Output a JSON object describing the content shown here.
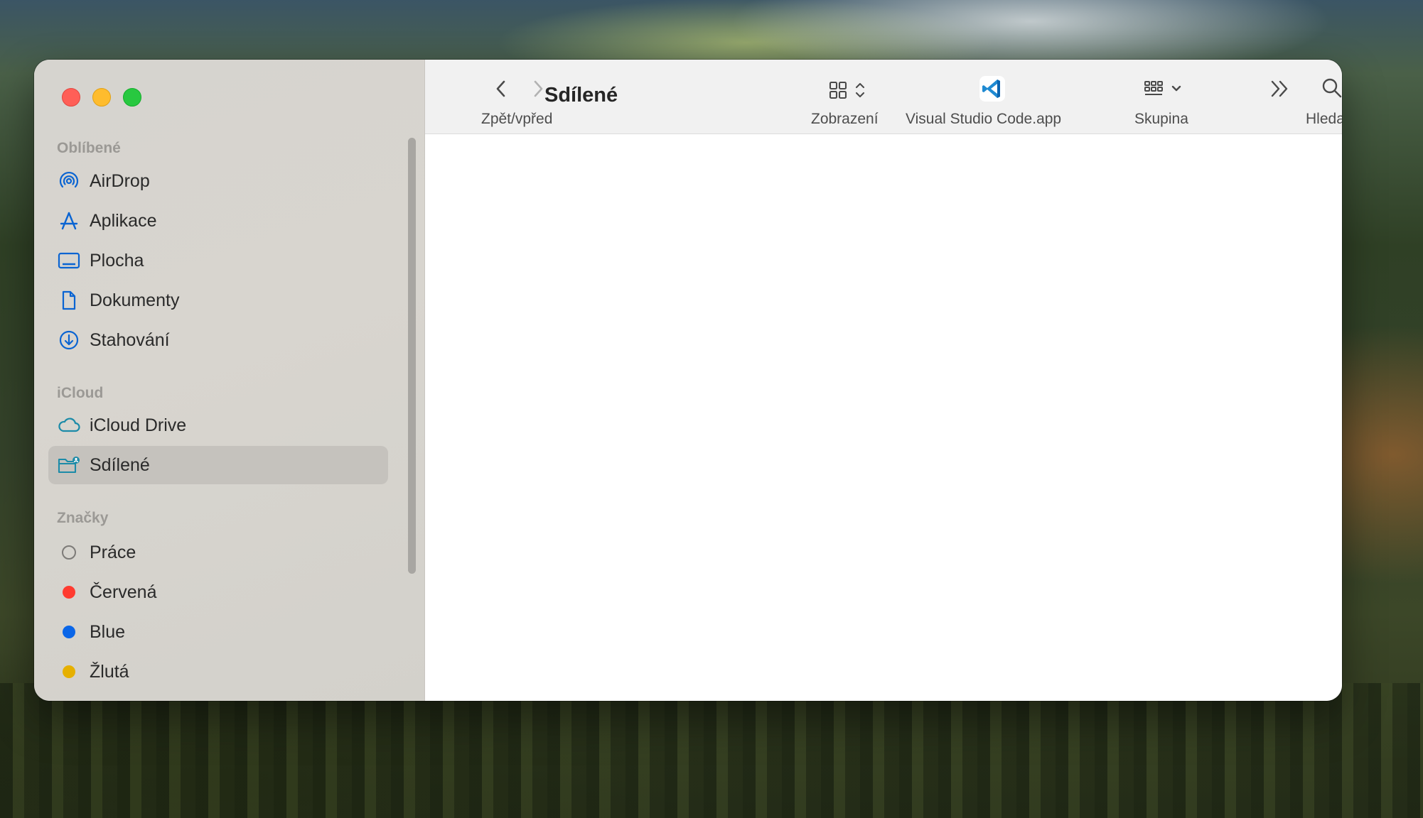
{
  "window": {
    "title": "Sdílené"
  },
  "toolbar": {
    "back_forward_label": "Zpět/vpřed",
    "view_label": "Zobrazení",
    "app_label": "Visual Studio Code.app",
    "group_label": "Skupina",
    "search_label": "Hledat"
  },
  "sidebar": {
    "favorites_title": "Oblíbené",
    "favorites": [
      {
        "label": "AirDrop",
        "icon": "airdrop-icon"
      },
      {
        "label": "Aplikace",
        "icon": "applications-icon"
      },
      {
        "label": "Plocha",
        "icon": "desktop-icon"
      },
      {
        "label": "Dokumenty",
        "icon": "document-icon"
      },
      {
        "label": "Stahování",
        "icon": "download-icon"
      }
    ],
    "icloud_title": "iCloud",
    "icloud": [
      {
        "label": "iCloud Drive",
        "icon": "cloud-icon"
      },
      {
        "label": "Sdílené",
        "icon": "shared-folder-icon",
        "selected": true
      }
    ],
    "tags_title": "Značky",
    "tags": [
      {
        "label": "Práce",
        "color": "#ffffff"
      },
      {
        "label": "Červená",
        "color": "#ff3b30"
      },
      {
        "label": "Blue",
        "color": "#0a66e8"
      },
      {
        "label": "Žlutá",
        "color": "#e6b000"
      }
    ]
  },
  "colors": {
    "accent": "#0a64d2",
    "vscode": "#1f8ad2"
  }
}
